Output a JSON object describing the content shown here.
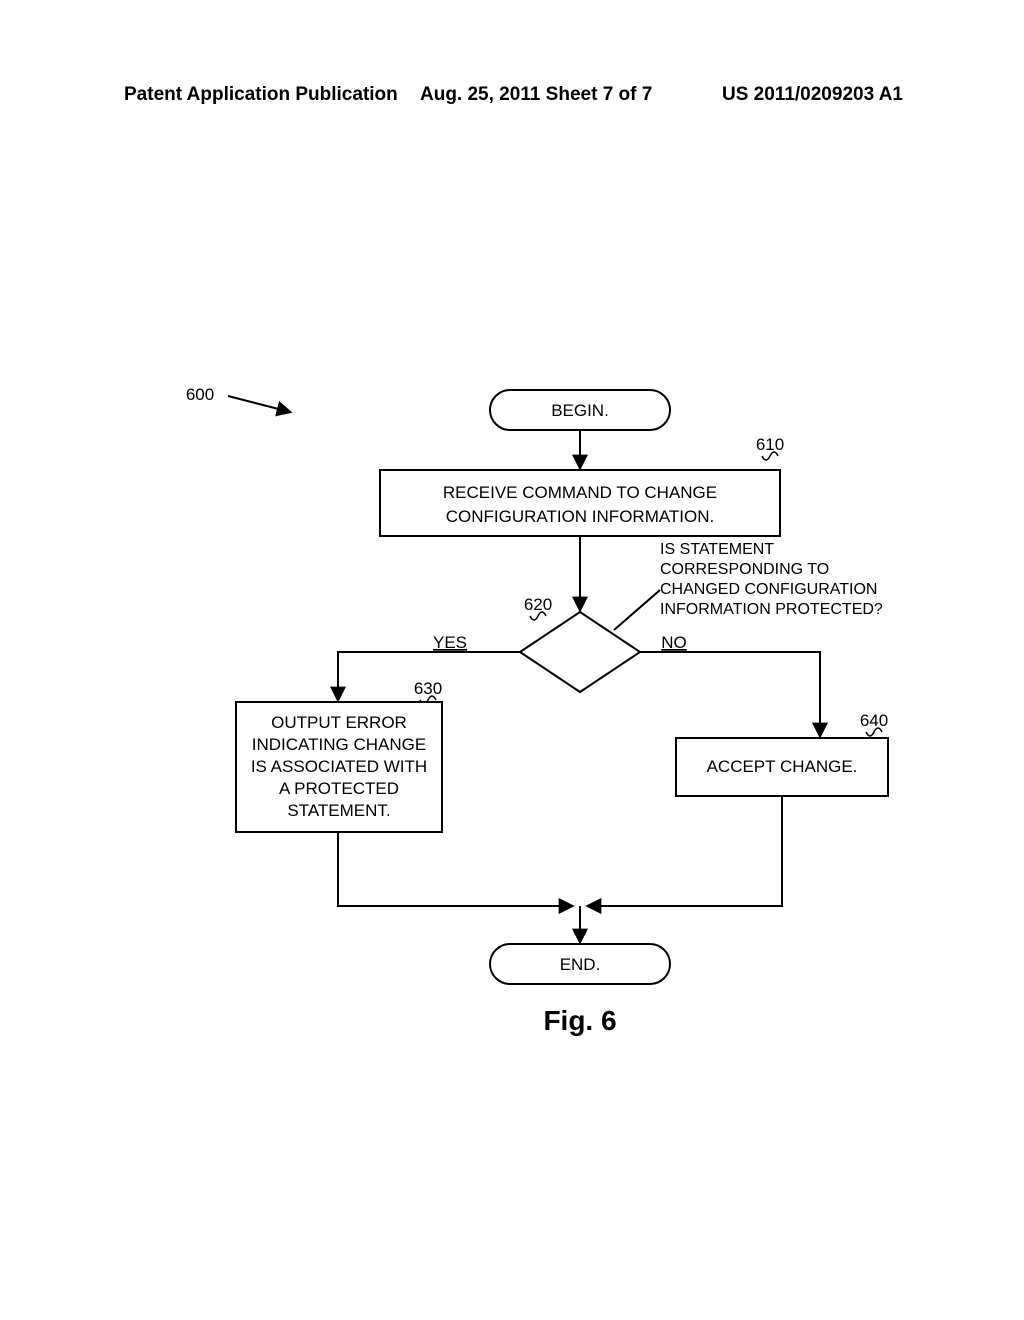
{
  "header": {
    "left": "Patent Application Publication",
    "middle": "Aug. 25, 2011  Sheet 7 of 7",
    "right": "US 2011/0209203 A1"
  },
  "flowchart": {
    "ref_main": "600",
    "begin": {
      "text": "BEGIN."
    },
    "step610": {
      "ref": "610",
      "lines": [
        "RECEIVE COMMAND TO CHANGE",
        "CONFIGURATION INFORMATION."
      ]
    },
    "decision620": {
      "ref": "620",
      "callout_lines": [
        "IS STATEMENT",
        "CORRESPONDING TO",
        "CHANGED CONFIGURATION",
        "INFORMATION PROTECTED?"
      ],
      "yes_label": "YES",
      "no_label": "NO"
    },
    "step630": {
      "ref": "630",
      "lines": [
        "OUTPUT ERROR",
        "INDICATING CHANGE",
        "IS ASSOCIATED WITH",
        "A PROTECTED",
        "STATEMENT."
      ]
    },
    "step640": {
      "ref": "640",
      "lines": [
        "ACCEPT CHANGE."
      ]
    },
    "end": {
      "text": "END."
    }
  },
  "figure_caption": "Fig. 6"
}
